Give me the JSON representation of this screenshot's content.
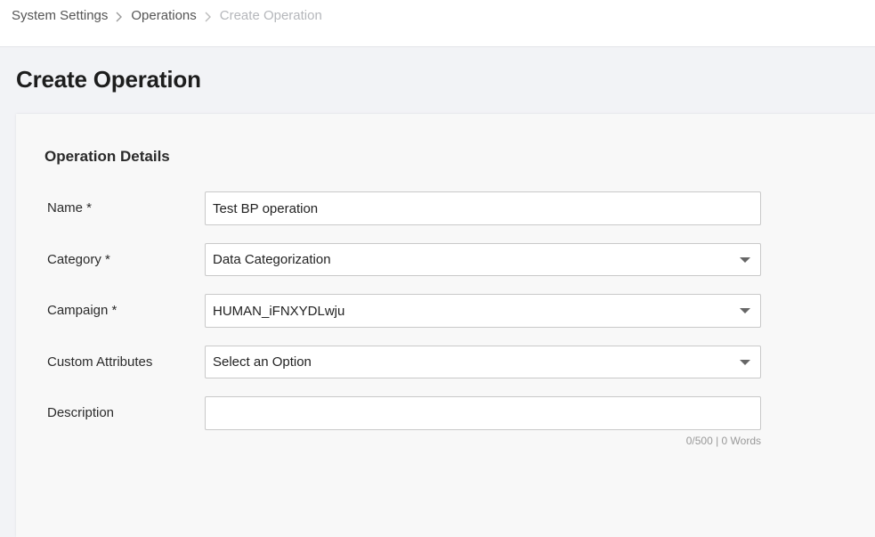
{
  "breadcrumb": {
    "items": [
      "System Settings",
      "Operations",
      "Create Operation"
    ]
  },
  "page": {
    "title": "Create Operation"
  },
  "form": {
    "section_title": "Operation Details",
    "name": {
      "label": "Name *",
      "value": "Test BP operation"
    },
    "category": {
      "label": "Category *",
      "value": "Data Categorization"
    },
    "campaign": {
      "label": "Campaign *",
      "value": "HUMAN_iFNXYDLwju"
    },
    "custom_attributes": {
      "label": "Custom Attributes",
      "value": "Select an Option"
    },
    "description": {
      "label": "Description",
      "value": "",
      "counter": "0/500 | 0 Words"
    }
  },
  "icons": {
    "breadcrumb_separator": "chevron-right-icon",
    "dropdown": "caret-down-icon"
  },
  "colors": {
    "page_background": "#f2f3f6",
    "card_background": "#f8f8f8",
    "breadcrumb_current": "#b5b7bb"
  }
}
